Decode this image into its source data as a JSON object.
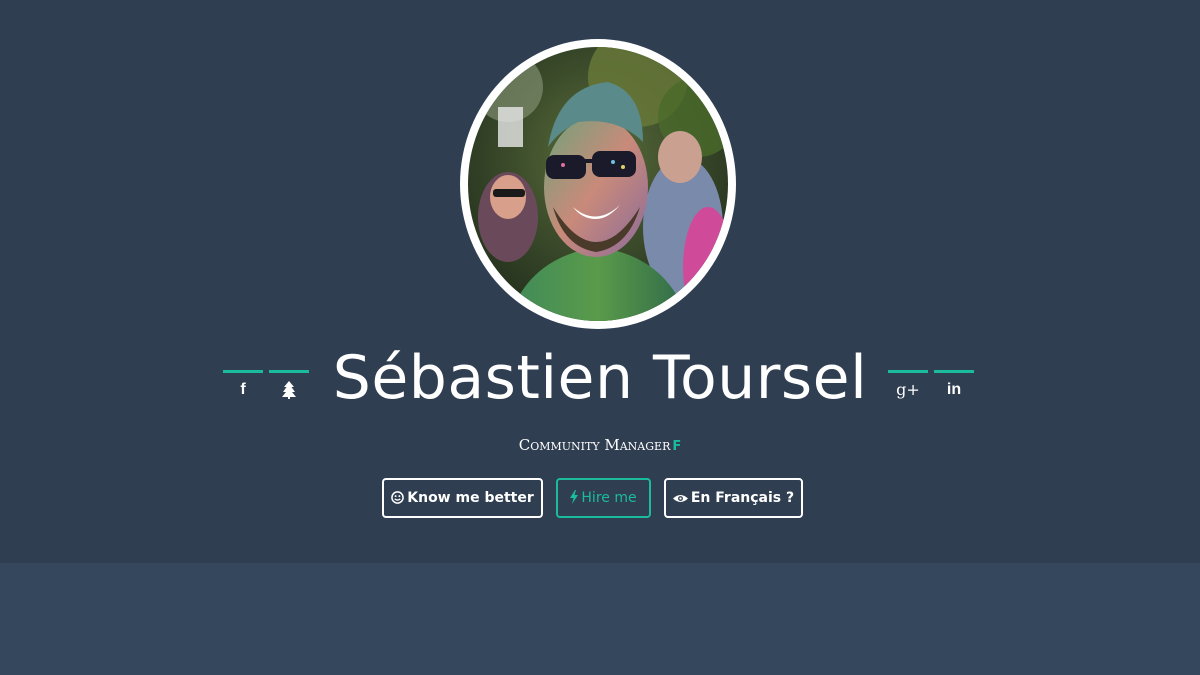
{
  "profile": {
    "name": "Sébastien Toursel",
    "title": "Community Manager"
  },
  "social_left": [
    {
      "icon": "facebook-icon",
      "glyph": "f"
    },
    {
      "icon": "tree-icon",
      "glyph": ""
    }
  ],
  "social_right": [
    {
      "icon": "google-plus-icon",
      "glyph": "g+"
    },
    {
      "icon": "linkedin-icon",
      "glyph": "in"
    }
  ],
  "buttons": {
    "know_label": "Know me better",
    "hire_label": "Hire me",
    "french_label": "En Français ?"
  },
  "colors": {
    "background": "#2f3e51",
    "lower_band": "#34475c",
    "accent": "#1abc9c",
    "text": "#ffffff"
  }
}
